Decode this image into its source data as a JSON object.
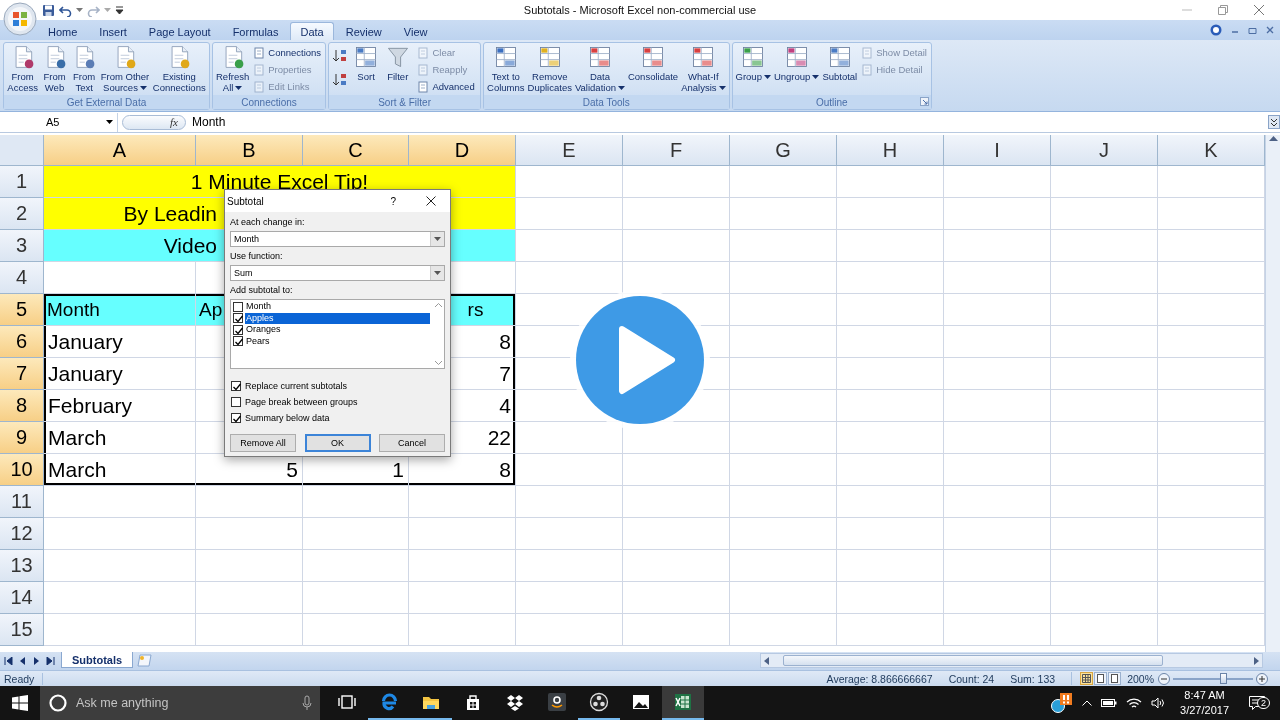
{
  "window": {
    "title": "Subtotals - Microsoft Excel non-commercial use"
  },
  "tabs": [
    {
      "label": "Home",
      "selected": false
    },
    {
      "label": "Insert",
      "selected": false
    },
    {
      "label": "Page Layout",
      "selected": false
    },
    {
      "label": "Formulas",
      "selected": false
    },
    {
      "label": "Data",
      "selected": true
    },
    {
      "label": "Review",
      "selected": false
    },
    {
      "label": "View",
      "selected": false
    }
  ],
  "ribbon_groups": [
    {
      "title": "Get External Data",
      "launcher": false,
      "items": [
        {
          "kind": "large",
          "label": "From\nAccess",
          "dropdown": false
        },
        {
          "kind": "large",
          "label": "From\nWeb",
          "dropdown": false
        },
        {
          "kind": "large",
          "label": "From\nText",
          "dropdown": false
        },
        {
          "kind": "large",
          "label": "From Other\nSources",
          "dropdown": true
        },
        {
          "kind": "large",
          "label": "Existing\nConnections",
          "dropdown": false
        }
      ]
    },
    {
      "title": "Connections",
      "launcher": false,
      "items": [
        {
          "kind": "large",
          "label": "Refresh\nAll",
          "dropdown": true
        },
        {
          "kind": "stack",
          "items": [
            {
              "label": "Connections",
              "disabled": false
            },
            {
              "label": "Properties",
              "disabled": true
            },
            {
              "label": "Edit Links",
              "disabled": true
            }
          ]
        }
      ]
    },
    {
      "title": "Sort & Filter",
      "launcher": false,
      "items": [
        {
          "kind": "sort-pair"
        },
        {
          "kind": "large",
          "label": "Sort",
          "dropdown": false
        },
        {
          "kind": "large",
          "label": "Filter",
          "dropdown": false
        },
        {
          "kind": "stack",
          "items": [
            {
              "label": "Clear",
              "disabled": true
            },
            {
              "label": "Reapply",
              "disabled": true
            },
            {
              "label": "Advanced",
              "disabled": false
            }
          ]
        }
      ]
    },
    {
      "title": "Data Tools",
      "launcher": false,
      "items": [
        {
          "kind": "large",
          "label": "Text to\nColumns",
          "dropdown": false
        },
        {
          "kind": "large",
          "label": "Remove\nDuplicates",
          "dropdown": false
        },
        {
          "kind": "large",
          "label": "Data\nValidation",
          "dropdown": true
        },
        {
          "kind": "large",
          "label": "Consolidate",
          "dropdown": false
        },
        {
          "kind": "large",
          "label": "What-If\nAnalysis",
          "dropdown": true
        }
      ]
    },
    {
      "title": "Outline",
      "launcher": true,
      "items": [
        {
          "kind": "large",
          "label": "Group",
          "dropdown": true
        },
        {
          "kind": "large",
          "label": "Ungroup",
          "dropdown": true
        },
        {
          "kind": "large",
          "label": "Subtotal",
          "dropdown": false
        },
        {
          "kind": "stack",
          "items": [
            {
              "label": "Show Detail",
              "disabled": true
            },
            {
              "label": "Hide Detail",
              "disabled": true
            }
          ]
        }
      ]
    }
  ],
  "formula_bar": {
    "name_box": "A5",
    "function_label": "fx",
    "value": "Month"
  },
  "sheet": {
    "columns": [
      {
        "label": "A",
        "selected": true
      },
      {
        "label": "B",
        "selected": true
      },
      {
        "label": "C",
        "selected": true
      },
      {
        "label": "D",
        "selected": true
      },
      {
        "label": "E",
        "selected": false
      },
      {
        "label": "F",
        "selected": false
      },
      {
        "label": "G",
        "selected": false
      },
      {
        "label": "H",
        "selected": false
      },
      {
        "label": "I",
        "selected": false
      },
      {
        "label": "J",
        "selected": false
      },
      {
        "label": "K",
        "selected": false
      }
    ],
    "rows": [
      {
        "number": "1",
        "selected": false,
        "kind": "banner",
        "color": "#ffff00",
        "cells": [
          {
            "text": "1 Minute Excel Tip!"
          }
        ]
      },
      {
        "number": "2",
        "selected": false,
        "kind": "banner-clipped",
        "color": "#ffff00",
        "cells": [
          {
            "text": "By Leadin"
          }
        ]
      },
      {
        "number": "3",
        "selected": false,
        "kind": "banner-clipped",
        "color": "#66ffff",
        "cells": [
          {
            "text": "Video"
          }
        ]
      },
      {
        "number": "4",
        "selected": false,
        "kind": "empty"
      },
      {
        "number": "5",
        "selected": true,
        "kind": "table-header",
        "color": "#66ffff",
        "cells": [
          {
            "text": "Month"
          },
          {
            "text": "Ap"
          },
          {},
          {
            "text": "rs"
          }
        ]
      },
      {
        "number": "6",
        "selected": true,
        "kind": "table-row",
        "cells": [
          {
            "text": "January"
          },
          {},
          {},
          {
            "text": "8"
          }
        ]
      },
      {
        "number": "7",
        "selected": true,
        "kind": "table-row",
        "cells": [
          {
            "text": "January"
          },
          {},
          {},
          {
            "text": "7"
          }
        ]
      },
      {
        "number": "8",
        "selected": true,
        "kind": "table-row",
        "cells": [
          {
            "text": "February"
          },
          {},
          {},
          {
            "text": "4"
          }
        ]
      },
      {
        "number": "9",
        "selected": true,
        "kind": "table-row",
        "cells": [
          {
            "text": "March"
          },
          {},
          {},
          {
            "text": "22"
          }
        ]
      },
      {
        "number": "10",
        "selected": true,
        "kind": "table-row",
        "cells": [
          {
            "text": "March"
          },
          {
            "text": "5"
          },
          {
            "text": "1"
          },
          {
            "text": "8"
          }
        ]
      },
      {
        "number": "11",
        "selected": false,
        "kind": "empty"
      },
      {
        "number": "12",
        "selected": false,
        "kind": "empty"
      },
      {
        "number": "13",
        "selected": false,
        "kind": "empty"
      },
      {
        "number": "14",
        "selected": false,
        "kind": "empty"
      },
      {
        "number": "15",
        "selected": false,
        "kind": "empty"
      }
    ]
  },
  "dialog": {
    "title": "Subtotal",
    "help": "?",
    "fields": [
      {
        "label": "At each change in:",
        "value": "Month"
      },
      {
        "label": "Use function:",
        "value": "Sum"
      }
    ],
    "list_label": "Add subtotal to:",
    "list": [
      {
        "label": "Month",
        "checked": false,
        "selected": false
      },
      {
        "label": "Apples",
        "checked": true,
        "selected": true
      },
      {
        "label": "Oranges",
        "checked": true,
        "selected": false
      },
      {
        "label": "Pears",
        "checked": true,
        "selected": false
      }
    ],
    "options": [
      {
        "label": "Replace current subtotals",
        "checked": true
      },
      {
        "label": "Page break between groups",
        "checked": false
      },
      {
        "label": "Summary below data",
        "checked": true
      }
    ],
    "buttons": [
      {
        "label": "Remove All",
        "default": false
      },
      {
        "label": "OK",
        "default": true
      },
      {
        "label": "Cancel",
        "default": false
      }
    ]
  },
  "sheet_tabs": [
    {
      "label": "Subtotals",
      "selected": true
    }
  ],
  "status_bar": {
    "mode": "Ready",
    "stats": [
      "Average: 8.866666667",
      "Count: 24",
      "Sum: 133"
    ],
    "views": [
      {
        "selected": true
      },
      {
        "selected": false
      },
      {
        "selected": false
      }
    ],
    "zoom": "200%",
    "zoom_slider": {
      "level": 0.63
    }
  },
  "taskbar": {
    "search": {
      "placeholder": "Ask me anything"
    },
    "apps": [
      {
        "running": false,
        "selected": false
      },
      {
        "running": true,
        "selected": false
      },
      {
        "running": true,
        "selected": false
      },
      {
        "running": false,
        "selected": false
      },
      {
        "running": false,
        "selected": false
      },
      {
        "running": false,
        "selected": false
      },
      {
        "running": true,
        "selected": false
      },
      {
        "running": false,
        "selected": false
      },
      {
        "running": true,
        "selected": true
      }
    ],
    "time": "8:47 AM",
    "date": "3/27/2017",
    "notifications": "2"
  }
}
